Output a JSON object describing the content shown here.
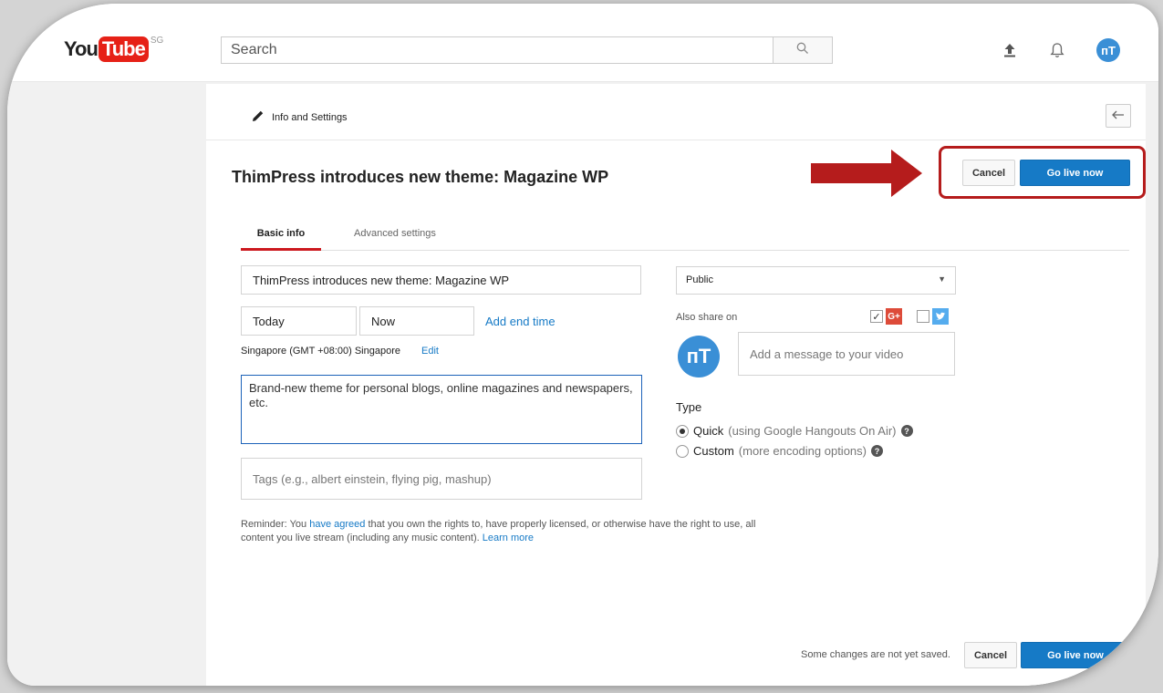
{
  "header": {
    "logo_you": "You",
    "logo_tube": "Tube",
    "logo_region": "SG",
    "search_placeholder": "Search"
  },
  "settings": {
    "section_title": "Info and Settings"
  },
  "video": {
    "title": "ThimPress introduces new theme: Magazine WP"
  },
  "actions_top": {
    "cancel_label": "Cancel",
    "go_live_label": "Go live now"
  },
  "tabs": [
    {
      "label": "Basic info",
      "active": true
    },
    {
      "label": "Advanced settings",
      "active": false
    }
  ],
  "form": {
    "title_value": "ThimPress introduces new theme: Magazine WP",
    "date_value": "Today",
    "time_value": "Now",
    "add_end_time": "Add end time",
    "timezone": "Singapore (GMT +08:00) Singapore",
    "edit_label": "Edit",
    "description": "Brand-new theme for personal blogs, online magazines and newspapers, etc.",
    "tags_placeholder": "Tags (e.g., albert einstein, flying pig, mashup)"
  },
  "privacy": {
    "selected": "Public"
  },
  "share": {
    "label": "Also share on",
    "gplus_label": "G+",
    "message_placeholder": "Add a message to your video"
  },
  "type": {
    "label": "Type",
    "quick_label": "Quick",
    "quick_note": "(using Google Hangouts On Air)",
    "custom_label": "Custom",
    "custom_note": "(more encoding options)"
  },
  "reminder": {
    "before": "Reminder: You ",
    "agreed_link": "have agreed",
    "after": " that you own the rights to, have properly licensed, or otherwise have the right to use, all content you live stream (including any music content). ",
    "learn_more": "Learn more"
  },
  "footer": {
    "unsaved_text": "Some changes are not yet saved.",
    "cancel_label": "Cancel",
    "go_live_label": "Go live now"
  },
  "avatar_initials": "ᴨT",
  "colors": {
    "accent": "#167ac6",
    "brand_red": "#e62117",
    "annotation_red": "#b51c1c"
  }
}
